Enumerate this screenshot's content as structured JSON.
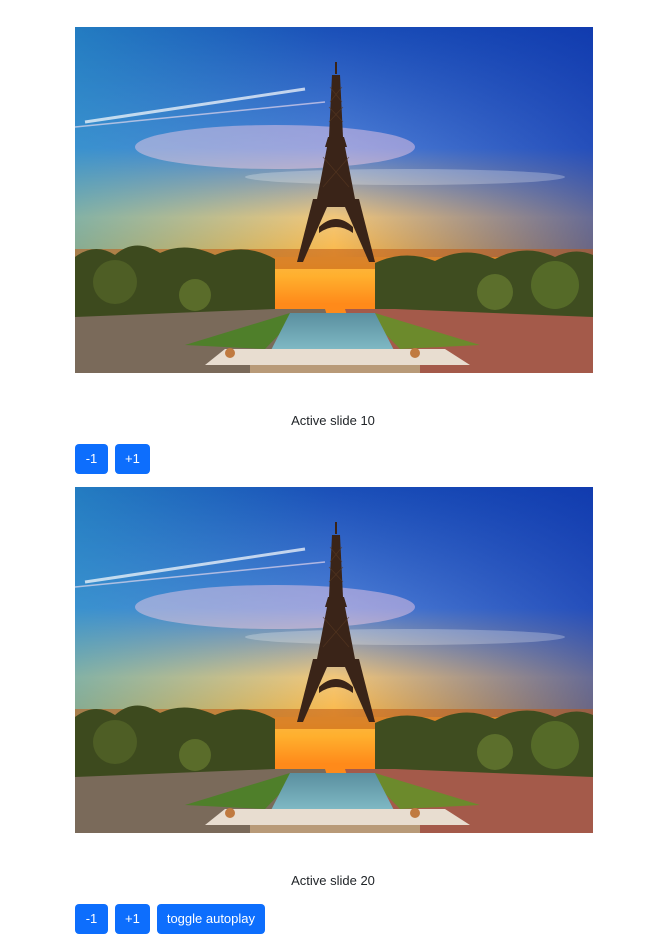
{
  "colors": {
    "button_bg": "#0d6efd",
    "button_text": "#ffffff",
    "text": "#212529"
  },
  "carousels": [
    {
      "slide_image": "eiffel-tower-sunset-photo",
      "caption": "Active slide 10",
      "buttons": {
        "prev": "-1",
        "next": "+1"
      }
    },
    {
      "slide_image": "eiffel-tower-sunset-photo",
      "caption": "Active slide 20",
      "buttons": {
        "prev": "-1",
        "next": "+1",
        "toggle_autoplay": "toggle autoplay"
      }
    }
  ]
}
